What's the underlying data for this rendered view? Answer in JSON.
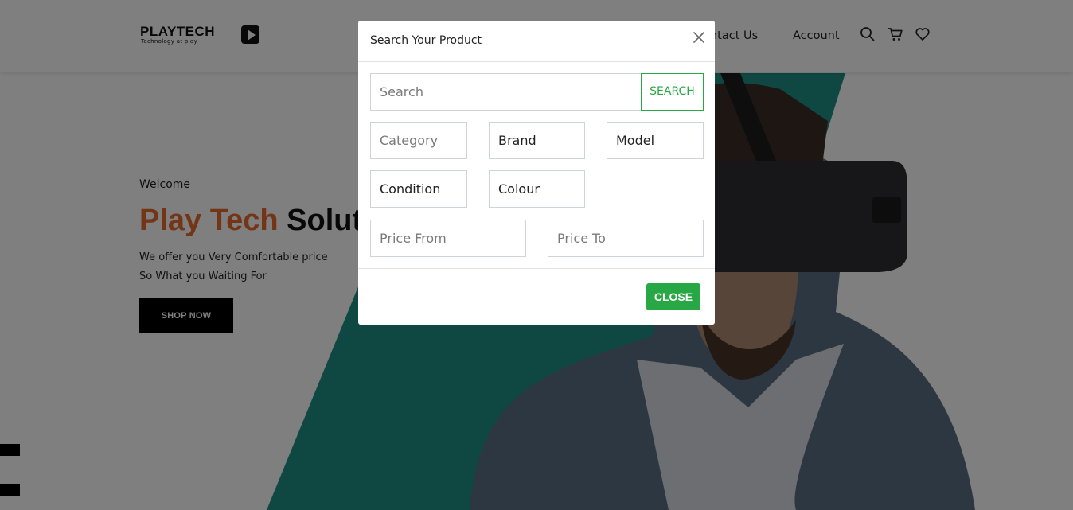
{
  "header": {
    "logo_text": "PLAYTECH",
    "logo_tagline": "Technology at play",
    "nav": {
      "contact_us": "Contact Us",
      "account": "Account"
    },
    "icons": [
      "search-icon",
      "cart-icon",
      "heart-icon"
    ]
  },
  "hero": {
    "welcome": "Welcome",
    "title_part1": "Play Tech",
    "title_part2": "Solut",
    "line1": "We offer you Very Comfortable price",
    "line2": "So What you Waiting For",
    "shop_button": "SHOP NOW",
    "accent_color": "#1f8f86"
  },
  "modal": {
    "title": "Search Your Product",
    "search_placeholder": "Search",
    "search_button": "SEARCH",
    "selects": {
      "category": "Category",
      "brand": "Brand",
      "model": "Model",
      "condition": "Condition",
      "colour": "Colour"
    },
    "price_from_placeholder": "Price From",
    "price_to_placeholder": "Price To",
    "close_button": "CLOSE",
    "button_color": "#28a745"
  }
}
